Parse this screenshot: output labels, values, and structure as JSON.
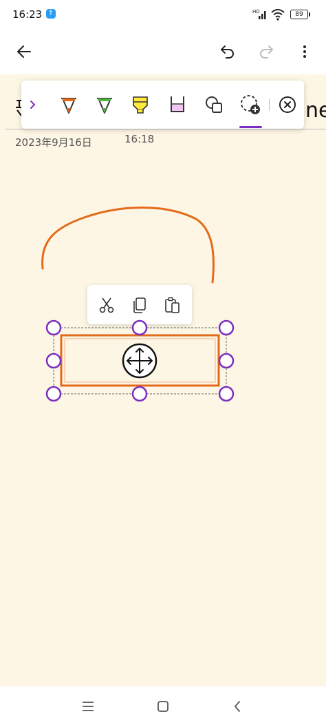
{
  "status": {
    "time": "16:23",
    "battery": "89",
    "hd_label": "HD"
  },
  "icons": {
    "back": "back-arrow-icon",
    "undo": "undo-icon",
    "redo": "redo-icon",
    "more": "more-vertical-icon",
    "toolbar": [
      "chevron-right-icon",
      "pen-orange-icon",
      "pen-green-icon",
      "highlighter-yellow-icon",
      "highlighter-pink-icon",
      "shapes-icon",
      "lasso-select-icon",
      "close-circle-icon"
    ],
    "context": [
      "cut-icon",
      "copy-icon",
      "paste-icon"
    ],
    "move": "move-icon"
  },
  "note": {
    "title_tail": "ne",
    "date": "2023年9月16日",
    "time": "16:18"
  },
  "colors": {
    "accent": "#7b2fbf",
    "ink_orange": "#e46a1a",
    "pen_green": "#52b043",
    "highlight_yellow": "#ffea3b",
    "highlight_pink": "#f1c6f3",
    "page_bg": "#fdf6e4"
  }
}
